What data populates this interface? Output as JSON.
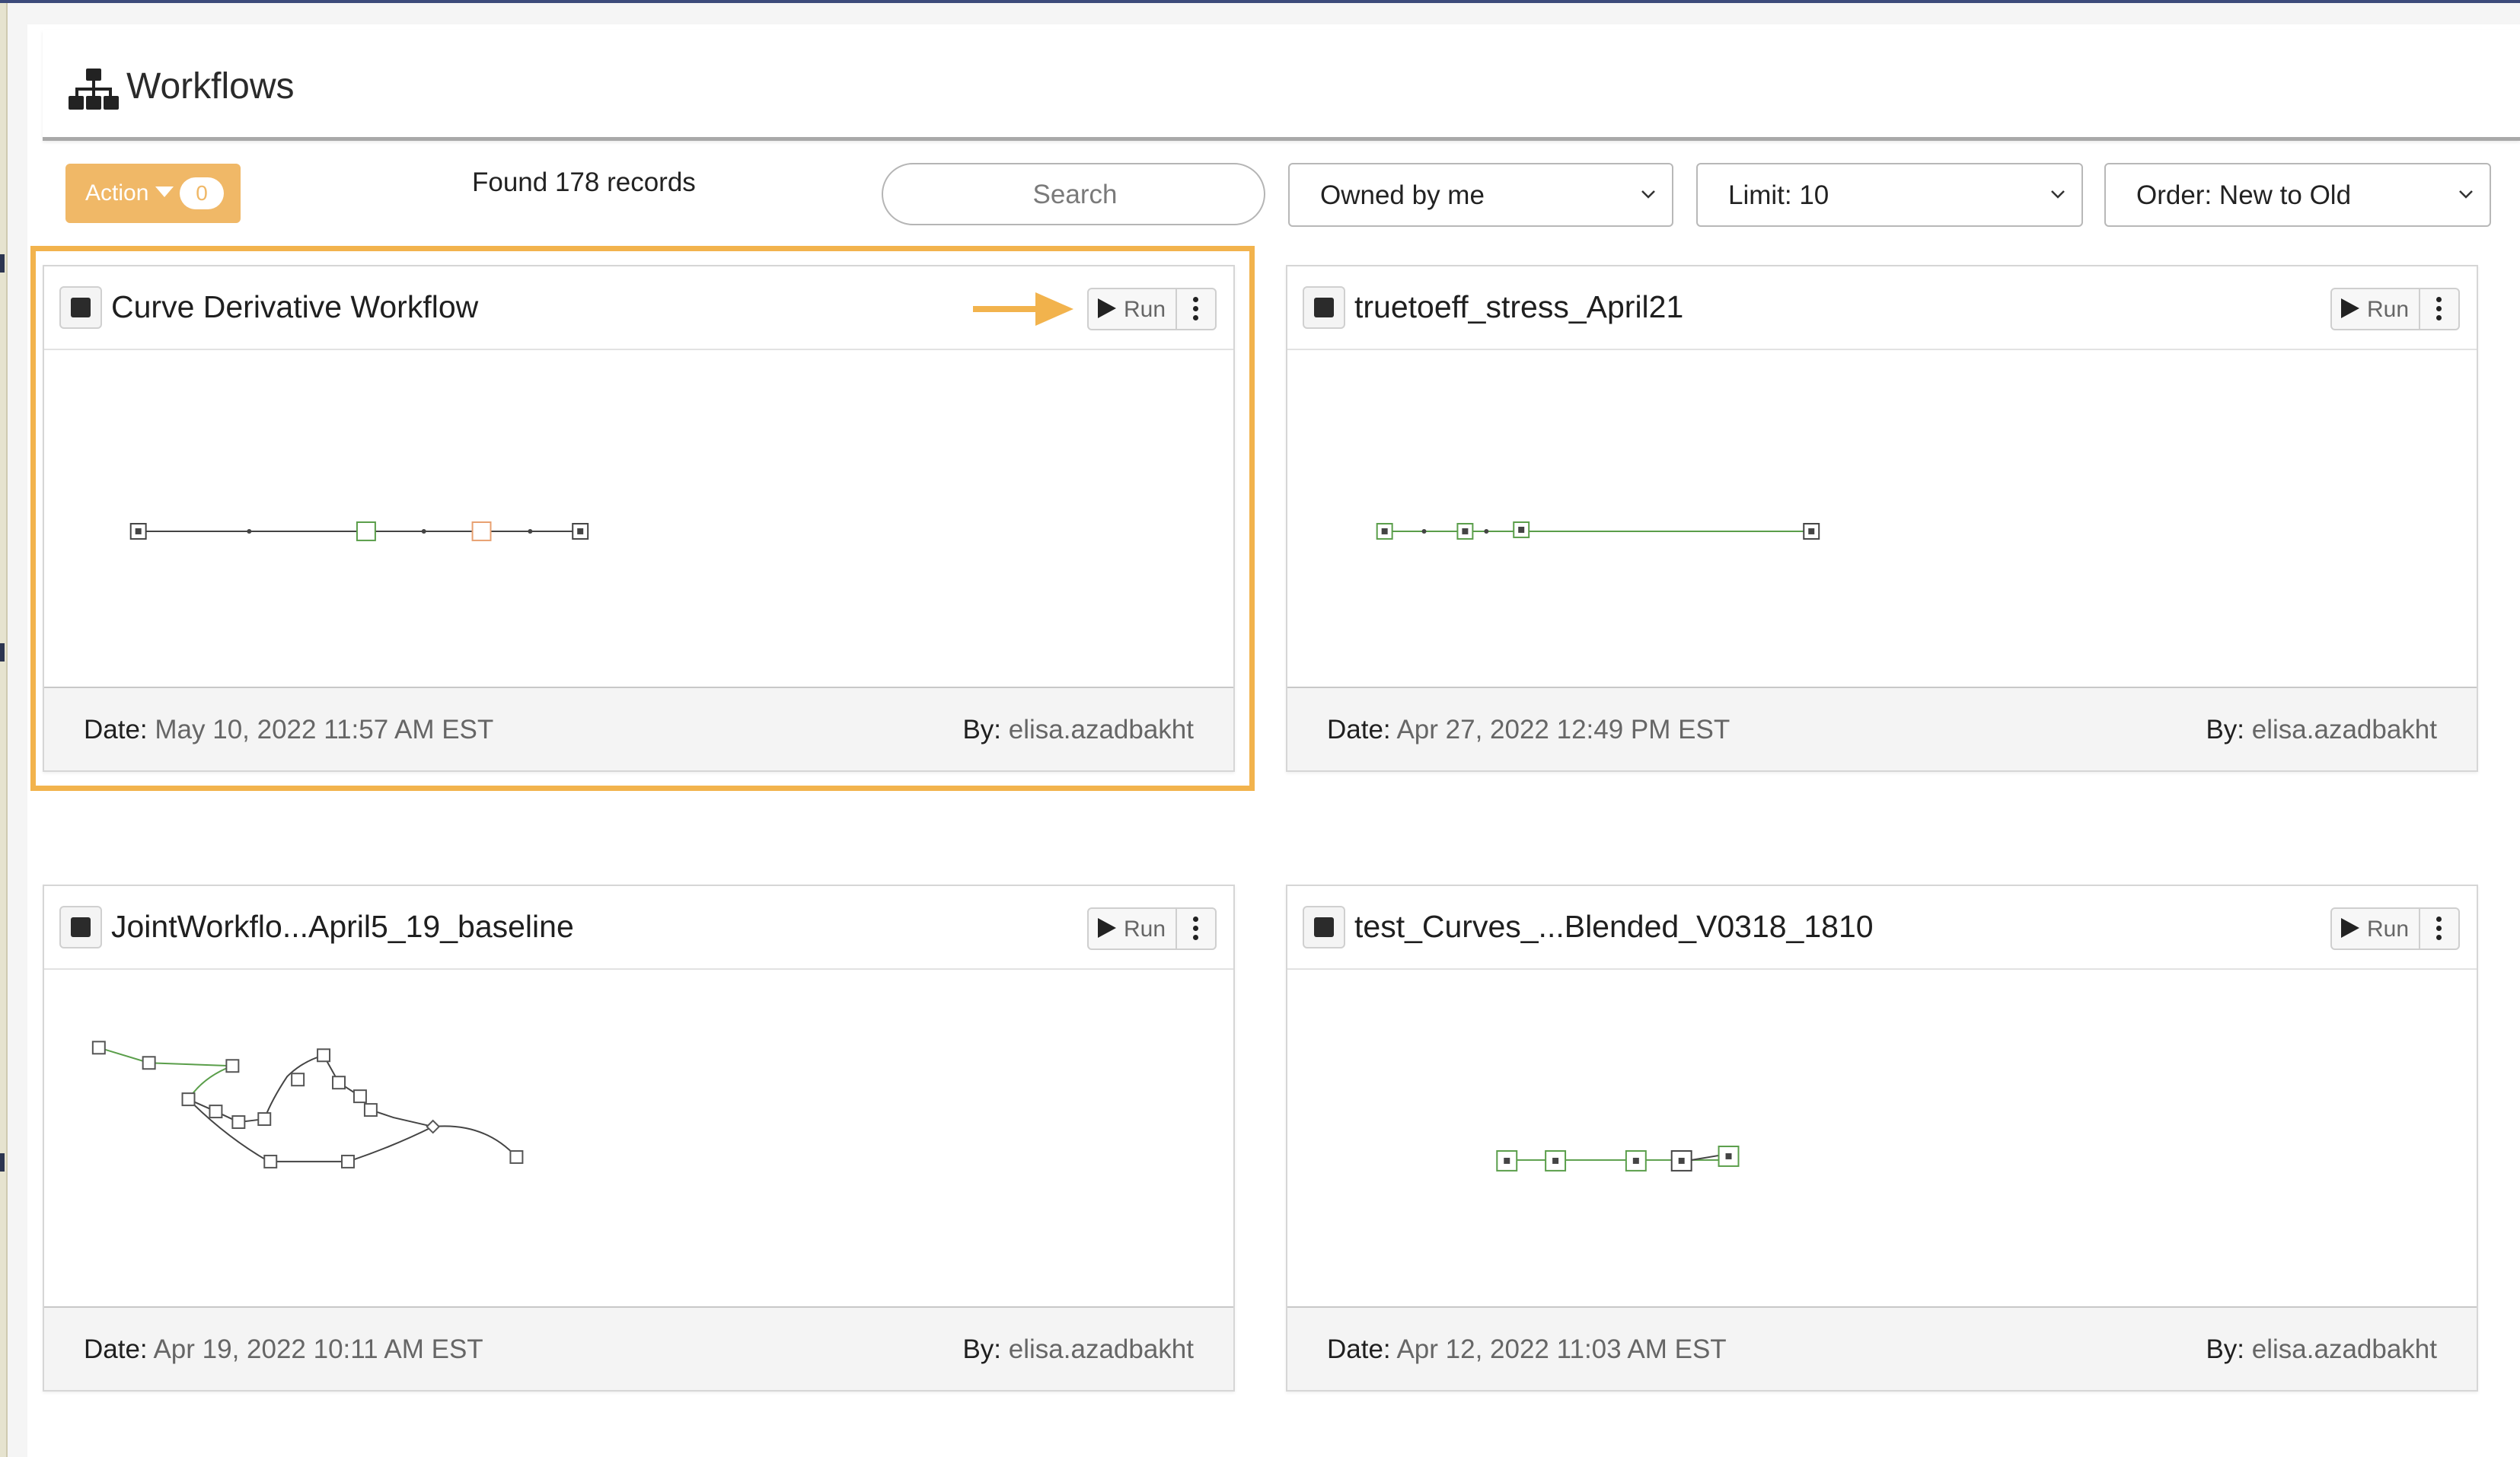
{
  "header": {
    "title": "Workflows",
    "icon": "sitemap-icon"
  },
  "toolbar": {
    "action_label": "Action",
    "action_count": "0",
    "found_text": "Found 178 records",
    "search_placeholder": "Search",
    "owner_filter": "Owned by me",
    "limit_filter": "Limit: 10",
    "order_filter": "Order: New to Old"
  },
  "colors": {
    "accent": "#f0b867",
    "highlight": "#f2b34d",
    "edge_green": "#5a9e4a",
    "node_orange": "#e8a070"
  },
  "cards": [
    {
      "title": "Curve Derivative Workflow",
      "run_label": "Run",
      "date_label": "Date:",
      "date": "May 10, 2022 11:57 AM EST",
      "by_label": "By:",
      "by": "elisa.azadbakht"
    },
    {
      "title": "truetoeff_stress_April21",
      "run_label": "Run",
      "date_label": "Date:",
      "date": "Apr 27, 2022 12:49 PM EST",
      "by_label": "By:",
      "by": "elisa.azadbakht"
    },
    {
      "title": "JointWorkflo...April5_19_baseline",
      "run_label": "Run",
      "date_label": "Date:",
      "date": "Apr 19, 2022 10:11 AM EST",
      "by_label": "By:",
      "by": "elisa.azadbakht"
    },
    {
      "title": "test_Curves_...Blended_V0318_1810",
      "run_label": "Run",
      "date_label": "Date:",
      "date": "Apr 12, 2022 11:03 AM EST",
      "by_label": "By:",
      "by": "elisa.azadbakht"
    }
  ]
}
